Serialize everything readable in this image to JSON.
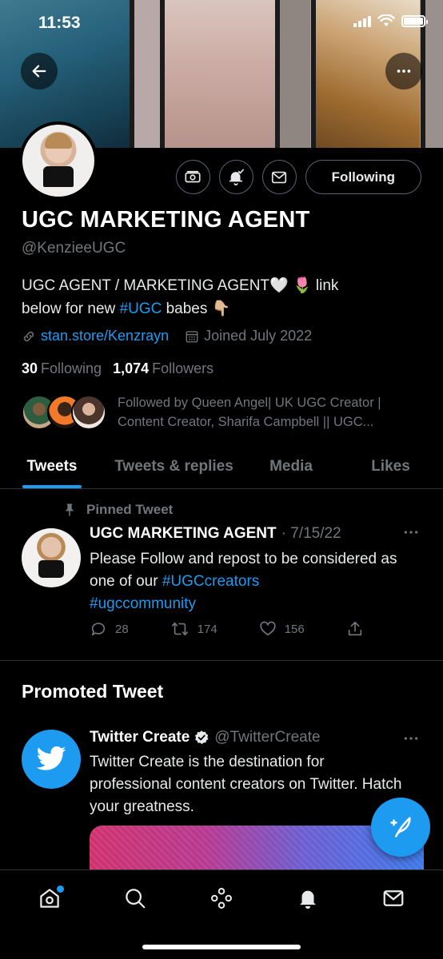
{
  "status_bar": {
    "time": "11:53"
  },
  "profile": {
    "name": "UGC MARKETING AGENT",
    "handle": "@KenzieeUGC",
    "bio_text_1": "UGC AGENT / MARKETING AGENT🤍 🌷  link",
    "bio_text_2": "below for new ",
    "bio_tag": "#UGC",
    "bio_text_3": " babes 👇🏼",
    "link": "stan.store/Kenzrayn",
    "joined": "Joined July 2022",
    "following_count": "30",
    "following_label": "Following",
    "followers_count": "1,074",
    "followers_label": "Followers",
    "followed_by": "Followed by Queen Angel| UK UGC Creator | Content Creator, Sharifa Campbell || UGC...",
    "following_button": "Following"
  },
  "tabs": [
    {
      "label": "Tweets",
      "active": true
    },
    {
      "label": "Tweets & replies",
      "active": false
    },
    {
      "label": "Media",
      "active": false
    },
    {
      "label": "Likes",
      "active": false
    }
  ],
  "pinned_tweet": {
    "pinned_label": "Pinned Tweet",
    "author": "UGC MARKETING AGENT",
    "date": "· 7/15/22",
    "text_1": "Please Follow and repost to be considered as one of our ",
    "tag_1": "#UGCcreators",
    "tag_2": "#ugccommunity",
    "replies": "28",
    "retweets": "174",
    "likes": "156"
  },
  "promoted": {
    "section_title": "Promoted Tweet",
    "author": "Twitter Create",
    "handle": "@TwitterCreate",
    "text": "Twitter Create is the destination for professional content creators on Twitter. Hatch your greatness."
  },
  "icons": {
    "back": "arrow-left-icon",
    "more": "more-horizontal-icon",
    "tip": "tip-jar-icon",
    "notify": "bell-check-icon",
    "message": "mail-icon",
    "link": "link-icon",
    "calendar": "calendar-icon",
    "pin": "pin-icon",
    "reply": "reply-icon",
    "retweet": "retweet-icon",
    "like": "heart-icon",
    "share": "share-icon",
    "verified": "verified-badge-icon",
    "compose": "compose-tweet-icon",
    "nav_home": "home-icon",
    "nav_search": "search-icon",
    "nav_spaces": "spaces-icon",
    "nav_notifications": "notifications-icon",
    "nav_messages": "messages-icon"
  },
  "colors": {
    "accent": "#1d9bf0",
    "background": "#000000",
    "secondary_text": "#71767b",
    "border": "#2f3336"
  }
}
